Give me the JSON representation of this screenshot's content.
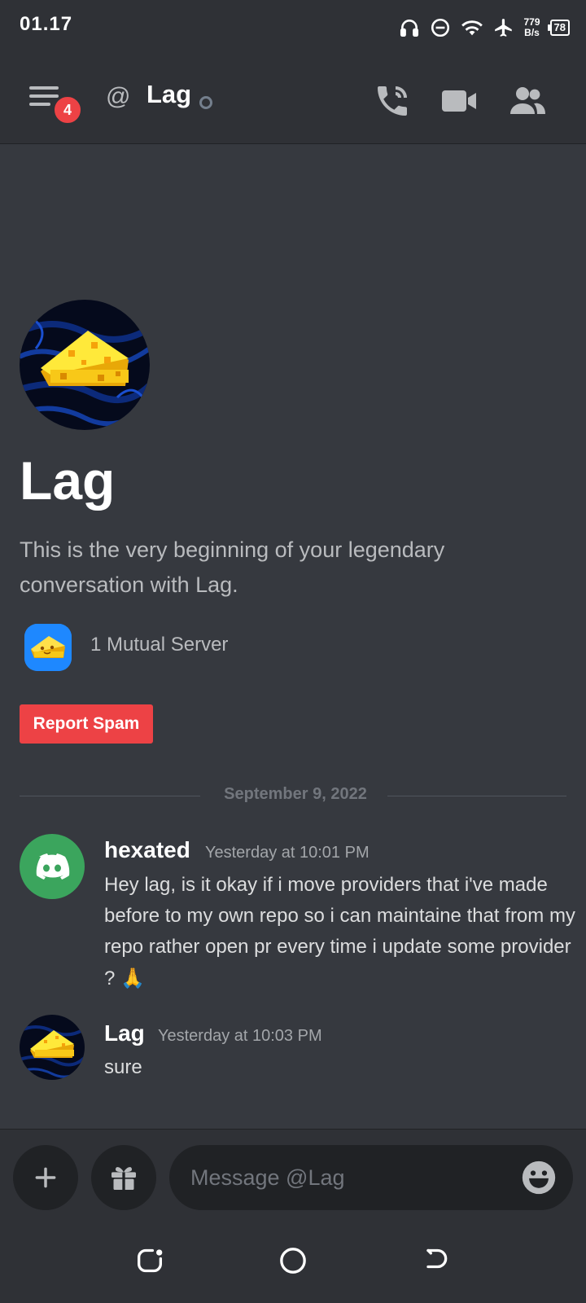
{
  "status_bar": {
    "time": "01.17",
    "net_speed_value": "779",
    "net_speed_unit": "B/s",
    "battery": "78",
    "icons": [
      "headphones-icon",
      "dnd-icon",
      "wifi-icon",
      "airplane-icon",
      "battery-icon"
    ]
  },
  "header": {
    "unread_badge": "4",
    "channel_prefix": "@",
    "title": "Lag"
  },
  "intro": {
    "name": "Lag",
    "text": "This is the very beginning of your legendary conversation with Lag.",
    "mutual_servers": "1 Mutual Server",
    "report_button": "Report Spam"
  },
  "date_divider": "September 9, 2022",
  "messages": [
    {
      "author": "hexated",
      "timestamp": "Yesterday at 10:01 PM",
      "content": "Hey lag, is it okay if i move providers that i've made before to my own repo so i can  maintaine that from my repo rather open pr every time i update some provider ?",
      "emoji": "🙏"
    },
    {
      "author": "Lag",
      "timestamp": "Yesterday at 10:03 PM",
      "content": "sure"
    }
  ],
  "composer": {
    "placeholder": "Message @Lag"
  },
  "colors": {
    "background": "#36393f",
    "header": "#2f3136",
    "input": "#202225",
    "danger": "#ed4245",
    "discord_green": "#3ba55d",
    "server_icon_blue": "#1e88ff"
  }
}
